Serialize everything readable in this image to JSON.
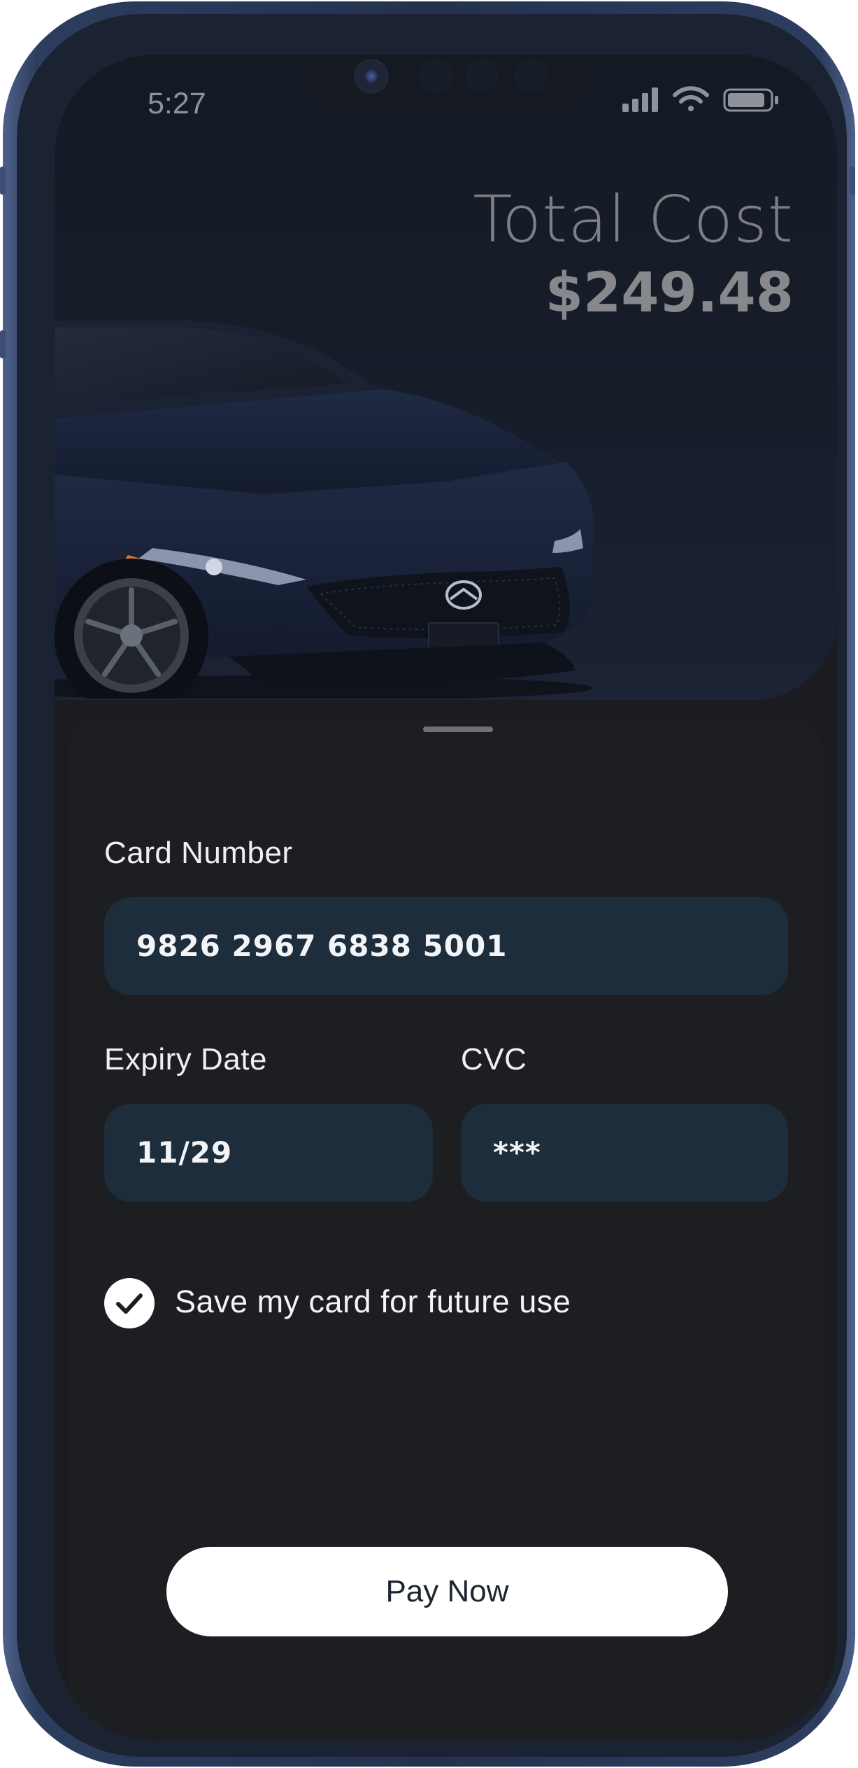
{
  "status_bar": {
    "time": "5:27",
    "icons": [
      "cellular-signal-icon",
      "wifi-icon",
      "battery-icon"
    ]
  },
  "summary": {
    "total_label": "Total Cost",
    "total_value": "$249.48"
  },
  "hero_image": {
    "subject": "car-image"
  },
  "form": {
    "card_number_label": "Card Number",
    "card_number_value": "9826 2967 6838 5001",
    "expiry_label": "Expiry Date",
    "expiry_value": "11/29",
    "cvc_label": "CVC",
    "cvc_value": "***",
    "save_card_label": "Save my card for future use",
    "save_card_checked": true
  },
  "actions": {
    "pay_label": "Pay Now"
  },
  "colors": {
    "sheet_bg": "#1d1e21",
    "field_bg": "#1e2d3c",
    "frame": "#243250",
    "button_bg": "#ffffff",
    "button_text": "#1d2532"
  }
}
